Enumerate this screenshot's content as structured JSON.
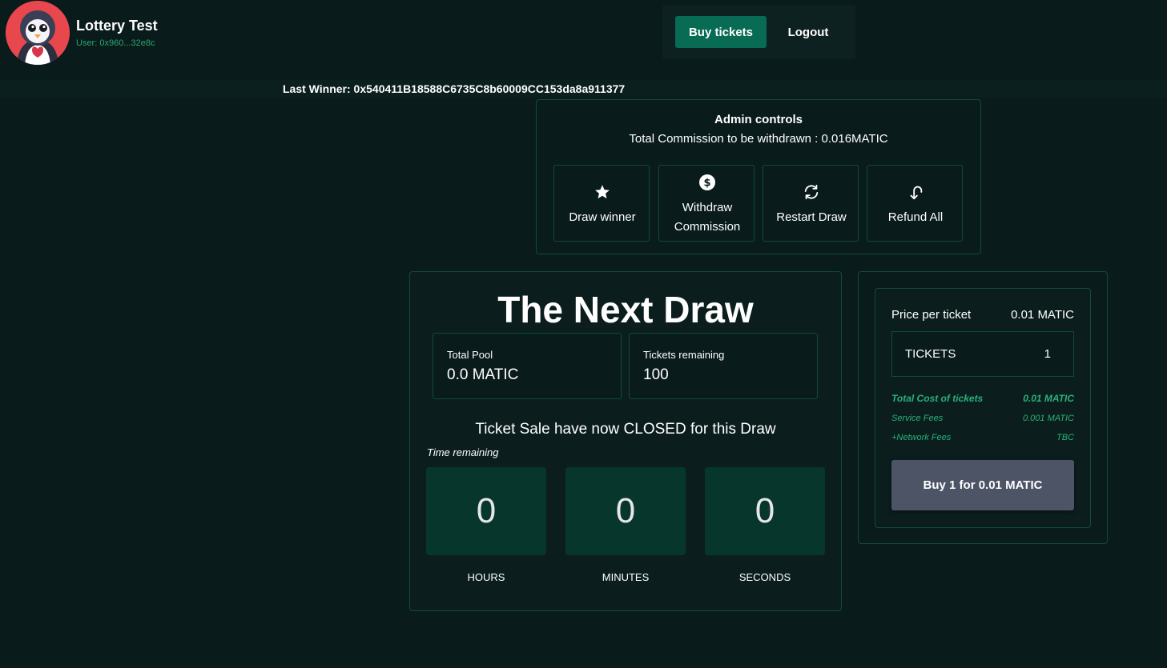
{
  "header": {
    "app_title": "Lottery Test",
    "user_label": "User: 0x960...32e8c",
    "logo_icon": "penguin-avatar-icon"
  },
  "nav": {
    "buy_tickets_label": "Buy tickets",
    "logout_label": "Logout"
  },
  "last_winner": "Last Winner: 0x540411B18588C6735C8b60009CC153da8a911377",
  "admin": {
    "title": "Admin controls",
    "commission_text": "Total Commission to be withdrawn : 0.016MATIC",
    "buttons": [
      {
        "label": "Draw winner",
        "icon": "star-icon"
      },
      {
        "label_line1": "Withdraw",
        "label_line2": "Commission",
        "icon": "dollar-circle-icon"
      },
      {
        "label": "Restart Draw",
        "icon": "refresh-icon"
      },
      {
        "label": "Refund All",
        "icon": "undo-arrow-icon"
      }
    ]
  },
  "draw": {
    "title": "The Next Draw",
    "total_pool_label": "Total Pool",
    "total_pool_value": "0.0 MATIC",
    "tickets_remaining_label": "Tickets remaining",
    "tickets_remaining_value": "100",
    "status_text": "Ticket Sale have now CLOSED for this Draw",
    "time_remaining_label": "Time remaining",
    "countdown": {
      "hours": "0",
      "minutes": "0",
      "seconds": "0",
      "hours_label": "HOURS",
      "minutes_label": "MINUTES",
      "seconds_label": "SECONDS"
    }
  },
  "purchase": {
    "price_label": "Price per ticket",
    "price_value": "0.01 MATIC",
    "tickets_label": "TICKETS",
    "tickets_value": "1",
    "total_cost_label": "Total Cost of tickets",
    "total_cost_value": "0.01 MATIC",
    "service_fees_label": "Service Fees",
    "service_fees_value": "0.001 MATIC",
    "network_fees_label": "+Network Fees",
    "network_fees_value": "TBC",
    "buy_button_label": "Buy 1 for 0.01 MATIC"
  },
  "colors": {
    "background": "#0a1b1c",
    "accent": "#086b54",
    "border": "#0e4a3e",
    "countdown_box": "#07362d",
    "fee_text": "#28b07a",
    "buy_button": "#4c5466",
    "logo_bg": "#e8474d"
  }
}
